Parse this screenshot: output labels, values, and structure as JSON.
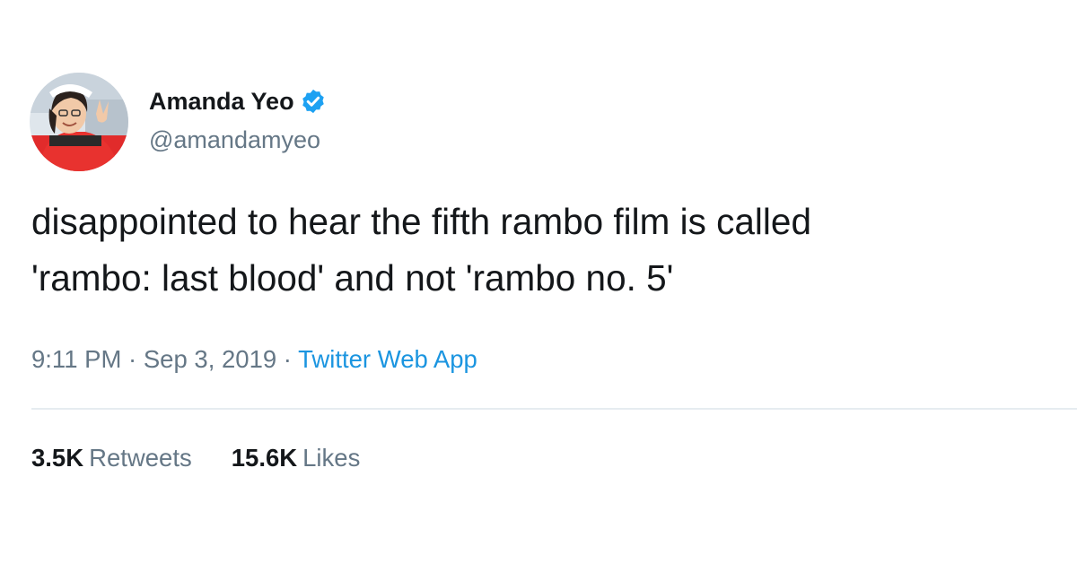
{
  "author": {
    "display_name": "Amanda Yeo",
    "handle": "@amandamyeo",
    "avatar_icon": "user-avatar",
    "verified_icon": "verified-badge-icon"
  },
  "tweet": {
    "text_line1": "disappointed to hear the fifth rambo film is called",
    "text_line2": "'rambo: last blood' and not 'rambo no. 5'"
  },
  "meta": {
    "time": "9:11 PM",
    "separator": "·",
    "date": "Sep 3, 2019",
    "source": "Twitter Web App"
  },
  "stats": {
    "retweets_count": "3.5K",
    "retweets_label": "Retweets",
    "likes_count": "15.6K",
    "likes_label": "Likes"
  },
  "colors": {
    "primary_text": "#14171a",
    "secondary_text": "#657786",
    "link": "#1b95e0",
    "verified": "#1da1f2",
    "divider": "#e6ecf0"
  }
}
